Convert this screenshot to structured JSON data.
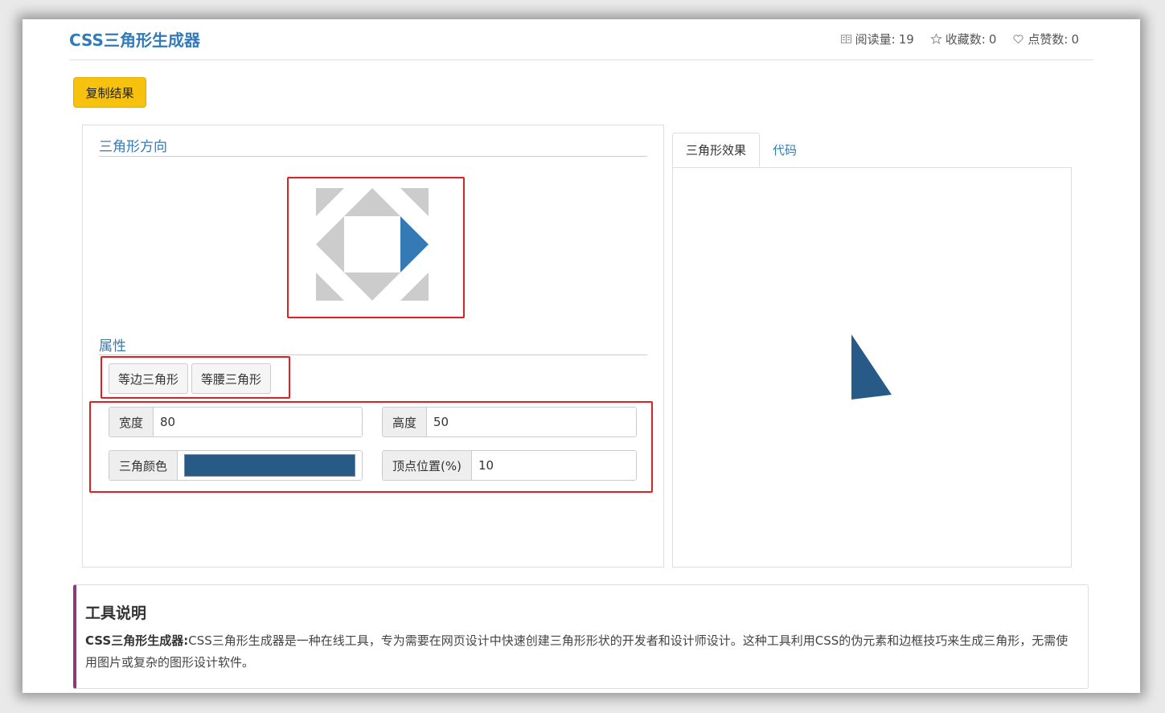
{
  "header": {
    "title": "CSS三角形生成器",
    "stats": [
      {
        "icon": "book-icon",
        "label": "阅读量:",
        "value": "19"
      },
      {
        "icon": "star-icon",
        "label": "收藏数:",
        "value": "0"
      },
      {
        "icon": "heart-icon",
        "label": "点赞数:",
        "value": "0"
      }
    ]
  },
  "toolbar": {
    "copy_label": "复制结果"
  },
  "direction": {
    "title": "三角形方向",
    "selected": "right"
  },
  "properties": {
    "title": "属性",
    "type_buttons": [
      "等边三角形",
      "等腰三角形"
    ],
    "width_label": "宽度",
    "width_value": "80",
    "height_label": "高度",
    "height_value": "50",
    "color_label": "三角颜色",
    "color_value": "#285a87",
    "apex_label": "顶点位置(%)",
    "apex_value": "10"
  },
  "tabs": {
    "effect": "三角形效果",
    "code": "代码"
  },
  "description": {
    "title": "工具说明",
    "lead": "CSS三角形生成器:",
    "text": "CSS三角形生成器是一种在线工具，专为需要在网页设计中快速创建三角形形状的开发者和设计师设计。这种工具利用CSS的伪元素和边框技巧来生成三角形，无需使用图片或复杂的图形设计软件。"
  },
  "colors": {
    "accent": "#337ab7",
    "triangle": "#285a87",
    "selected_dir": "#337ab7",
    "dir_inactive": "#cccccc",
    "copy_button": "#f7c20e"
  }
}
